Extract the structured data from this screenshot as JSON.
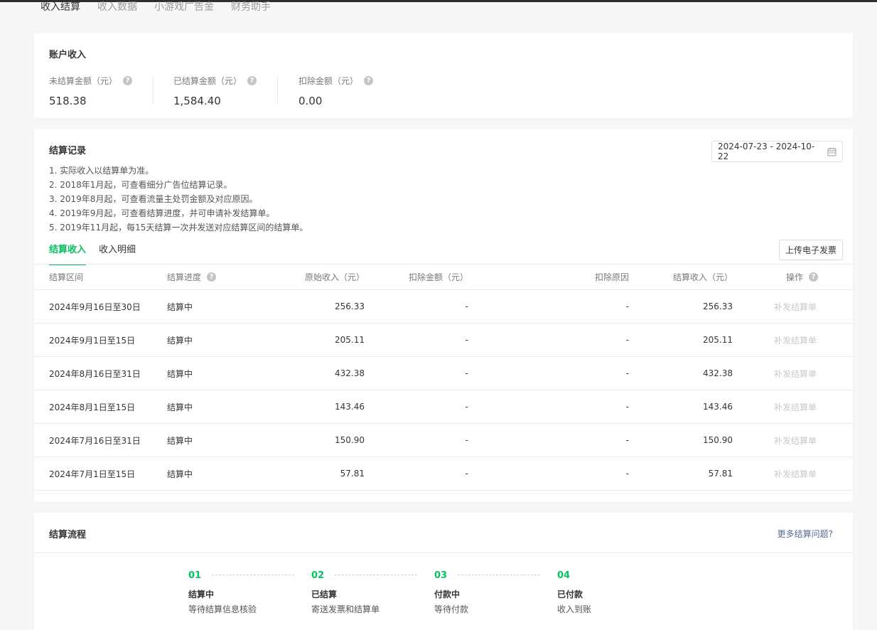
{
  "nav": {
    "tabs": [
      "收入结算",
      "收入数据",
      "小游戏广告金",
      "财务助手"
    ],
    "active": 0
  },
  "account": {
    "title": "账户收入",
    "stats": [
      {
        "label": "未结算金额（元）",
        "value": "518.38"
      },
      {
        "label": "已结算金额（元）",
        "value": "1,584.40"
      },
      {
        "label": "扣除金额（元）",
        "value": "0.00"
      }
    ]
  },
  "settlement": {
    "title": "结算记录",
    "notes": [
      "1. 实际收入以结算单为准。",
      "2. 2018年1月起，可查看细分广告位结算记录。",
      "3. 2019年8月起，可查看流量主处罚金额及对应原因。",
      "4. 2019年9月起，可查看结算进度，并可申请补发结算单。",
      "5. 2019年11月起，每15天结算一次并发送对应结算区间的结算单。"
    ],
    "date_range": "2024-07-23 - 2024-10-22",
    "subtabs": [
      "结算收入",
      "收入明细"
    ],
    "upload_label": "上传电子发票",
    "columns": {
      "period": "结算区间",
      "progress": "结算进度",
      "original": "原始收入（元）",
      "deduct": "扣除金额（元）",
      "reason": "扣除原因",
      "income": "结算收入（元）",
      "op": "操作"
    },
    "rows": [
      {
        "period": "2024年9月16日至30日",
        "progress": "结算中",
        "original": "256.33",
        "deduct": "-",
        "reason": "-",
        "income": "256.33",
        "op": "补发结算单"
      },
      {
        "period": "2024年9月1日至15日",
        "progress": "结算中",
        "original": "205.11",
        "deduct": "-",
        "reason": "-",
        "income": "205.11",
        "op": "补发结算单"
      },
      {
        "period": "2024年8月16日至31日",
        "progress": "结算中",
        "original": "432.38",
        "deduct": "-",
        "reason": "-",
        "income": "432.38",
        "op": "补发结算单"
      },
      {
        "period": "2024年8月1日至15日",
        "progress": "结算中",
        "original": "143.46",
        "deduct": "-",
        "reason": "-",
        "income": "143.46",
        "op": "补发结算单"
      },
      {
        "period": "2024年7月16日至31日",
        "progress": "结算中",
        "original": "150.90",
        "deduct": "-",
        "reason": "-",
        "income": "150.90",
        "op": "补发结算单"
      },
      {
        "period": "2024年7月1日至15日",
        "progress": "结算中",
        "original": "57.81",
        "deduct": "-",
        "reason": "-",
        "income": "57.81",
        "op": "补发结算单"
      }
    ]
  },
  "flow": {
    "title": "结算流程",
    "more_link": "更多结算问题?",
    "steps": [
      {
        "num": "01",
        "title": "结算中",
        "desc": "等待结算信息核验"
      },
      {
        "num": "02",
        "title": "已结算",
        "desc": "寄送发票和结算单"
      },
      {
        "num": "03",
        "title": "付款中",
        "desc": "等待付款"
      },
      {
        "num": "04",
        "title": "已付款",
        "desc": "收入到账"
      }
    ]
  },
  "colors": {
    "accent": "#07c160",
    "link": "#576b95",
    "disabled": "#c9c9c9"
  },
  "icons": {
    "help": "question-circle-icon",
    "calendar": "calendar-icon"
  }
}
